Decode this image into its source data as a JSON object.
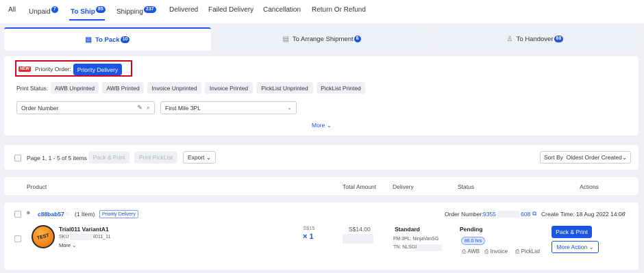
{
  "top_tabs": [
    {
      "label": "All"
    },
    {
      "label": "Unpaid",
      "count": "7"
    },
    {
      "label": "To Ship",
      "count": "85"
    },
    {
      "label": "Shipping",
      "count": "237"
    },
    {
      "label": "Delivered"
    },
    {
      "label": "Failed Delivery"
    },
    {
      "label": "Cancellation"
    },
    {
      "label": "Return Or Refund"
    }
  ],
  "sub_tabs": [
    {
      "label": "To Pack",
      "count": "10",
      "icon": "package-icon"
    },
    {
      "label": "To Arrange Shipment",
      "count": "6",
      "icon": "box-icon"
    },
    {
      "label": "To Handover",
      "count": "69",
      "icon": "handover-icon"
    }
  ],
  "filters": {
    "new_tag": "NEW",
    "priority_label": "Priority Order:",
    "priority_button": "Priority Delivery",
    "print_status_label": "Print Status:",
    "print_chips": [
      "AWB Unprinted",
      "AWB Printed",
      "Invoice Unprinted",
      "Invoice Printed",
      "PickList Unprinted",
      "PickList Printed"
    ],
    "order_number_placeholder": "Order Number",
    "first_mile_value": "First Mile 3PL",
    "more_label": "More"
  },
  "toolbar": {
    "page_info": "Page 1, 1 - 5 of 5 items",
    "pack_print": "Pack & Print",
    "print_picklist": "Print PickList",
    "export": "Export",
    "sort_label": "Sort By",
    "sort_value": "Oldest Order Created"
  },
  "table_headers": [
    "Product",
    "Total Amount",
    "Delivery",
    "Status",
    "Actions"
  ],
  "order": {
    "buyer": "c88bab57",
    "item_count": "(1 Item)",
    "priority_tag": "Priority Delivery",
    "order_number_label": "Order Number:",
    "order_number_start": "9355",
    "order_number_end": "608",
    "create_time": "Create Time: 18 Aug 2022 14:06",
    "product_image_text": "TEST",
    "product_name": "Trial011 VariantA1",
    "sku_label": "SKU",
    "sku_suffix": "il011_11",
    "more_label": "More",
    "unit_price": "S$15",
    "quantity": "× 1",
    "total": "S$14.00",
    "delivery_type": "Standard",
    "fm_3pl": "FM 3PL: NinjaVanSG",
    "tn": "TN: NLSGD",
    "status": "Pending",
    "hours": "86.0 hrs",
    "print_items": [
      "AWB",
      "Invoice",
      "PickList"
    ],
    "pack_print_button": "Pack & Print",
    "more_action_button": "More Action"
  },
  "colors": {
    "accent": "#1a55e6",
    "highlight_border": "#d0021b",
    "new_tag": "#e32b2b"
  }
}
